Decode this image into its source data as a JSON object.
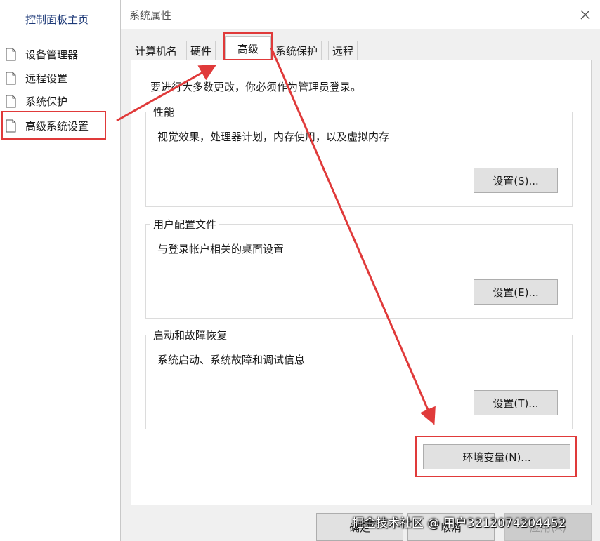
{
  "left_panel": {
    "home_link": "控制面板主页",
    "items": [
      {
        "label": "设备管理器"
      },
      {
        "label": "远程设置"
      },
      {
        "label": "系统保护"
      },
      {
        "label": "高级系统设置"
      }
    ]
  },
  "dialog": {
    "title": "系统属性",
    "tabs": [
      "计算机名",
      "硬件",
      "高级",
      "系统保护",
      "远程"
    ],
    "active_tab": "高级",
    "notice": "要进行大多数更改，你必须作为管理员登录。",
    "groups": {
      "performance": {
        "legend": "性能",
        "desc": "视觉效果，处理器计划，内存使用，以及虚拟内存",
        "button": "设置(S)..."
      },
      "user_profiles": {
        "legend": "用户配置文件",
        "desc": "与登录帐户相关的桌面设置",
        "button": "设置(E)..."
      },
      "startup_recovery": {
        "legend": "启动和故障恢复",
        "desc": "系统启动、系统故障和调试信息",
        "button": "设置(T)..."
      }
    },
    "env_button": "环境变量(N)...",
    "footer": {
      "ok": "确定",
      "cancel": "取消",
      "apply": "应用(A)"
    }
  },
  "watermark": "掘金技术社区 @ 用户3212074204452",
  "colors": {
    "highlight": "#e03a3a",
    "home_link": "#1e3a78",
    "dialog_bg": "#f0f0f0"
  },
  "icons": {
    "nav_item": "document-icon",
    "close": "close-icon"
  }
}
